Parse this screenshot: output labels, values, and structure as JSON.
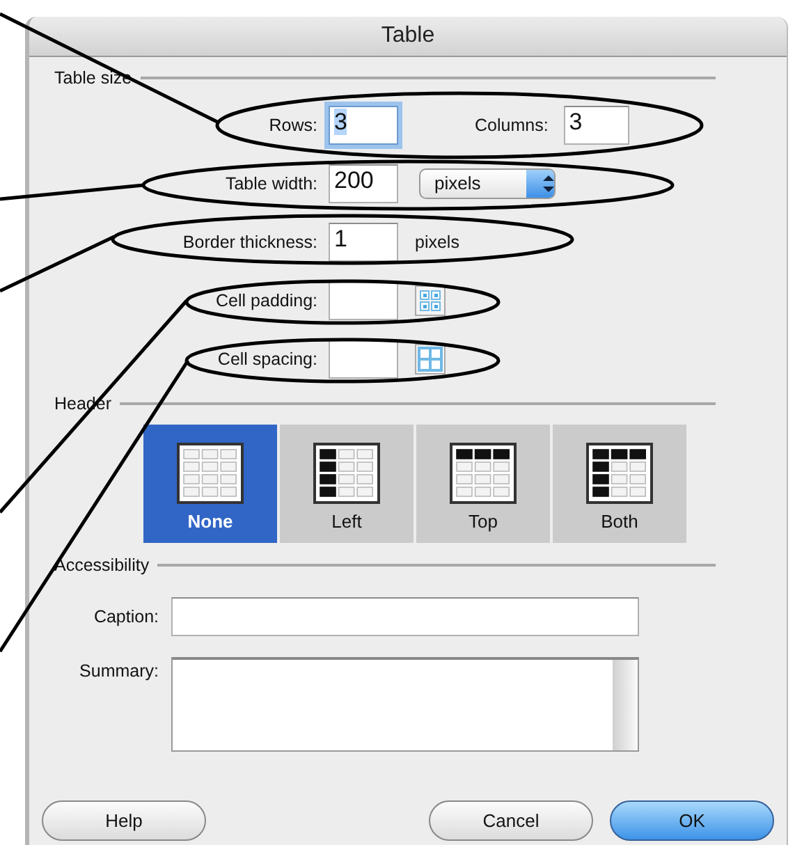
{
  "window": {
    "title": "Table"
  },
  "table_size": {
    "legend": "Table size",
    "rows": {
      "label": "Rows:",
      "value": "3",
      "focused": true
    },
    "columns": {
      "label": "Columns:",
      "value": "3"
    },
    "table_width": {
      "label": "Table width:",
      "value": "200",
      "unit": "pixels"
    },
    "border_thickness": {
      "label": "Border thickness:",
      "value": "1",
      "unit": "pixels"
    },
    "cell_padding": {
      "label": "Cell padding:"
    },
    "cell_spacing": {
      "label": "Cell spacing:"
    }
  },
  "header": {
    "legend": "Header",
    "options": [
      {
        "label": "None",
        "kind": "none",
        "selected": true
      },
      {
        "label": "Left",
        "kind": "left",
        "selected": false
      },
      {
        "label": "Top",
        "kind": "top",
        "selected": false
      },
      {
        "label": "Both",
        "kind": "both",
        "selected": false
      }
    ]
  },
  "accessibility": {
    "legend": "Accessibility",
    "caption": {
      "label": "Caption:"
    },
    "summary": {
      "label": "Summary:"
    }
  },
  "buttons": [
    {
      "label": "Help",
      "kind": "plain"
    },
    {
      "label": "Cancel",
      "kind": "plain"
    },
    {
      "label": "OK",
      "kind": "default"
    }
  ]
}
